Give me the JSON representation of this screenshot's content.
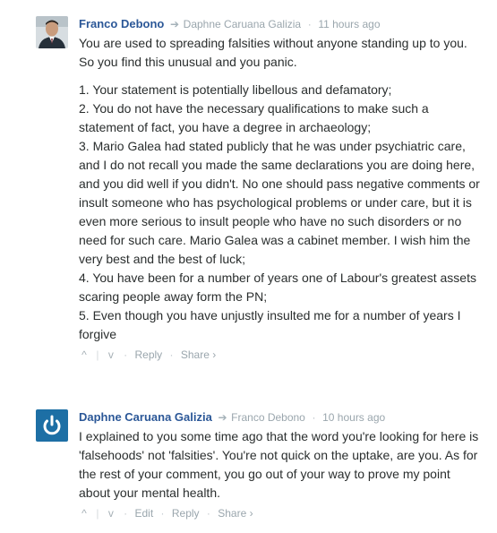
{
  "comments": [
    {
      "author": "Franco Debono",
      "reply_to": "Daphne Caruana Galizia",
      "separator": "·",
      "time": "11 hours ago",
      "paragraphs": [
        "You are used to spreading falsities without anyone standing up to you. So you find this unusual and you panic.",
        "1. Your statement is potentially libellous and defamatory;\n2. You do not have the necessary qualifications to make such a statement of fact, you have a degree in archaeology;\n3. Mario Galea had stated publicly that he was under psychiatric care, and I do not recall you made the same declarations you are doing here, and you did well if you didn't. No one should pass negative comments or insult someone who has psychological problems or under care, but it is even more serious to insult people who have no such disorders or no need for such care. Mario Galea was a cabinet member. I wish him the very best and the best of luck;\n4. You have been for a number of years one of Labour's greatest assets scaring people away form the PN;\n5. Even though you have unjustly insulted me for a number of years I forgive"
      ],
      "actions": {
        "reply": "Reply",
        "share": "Share ›"
      }
    },
    {
      "author": "Daphne Caruana Galizia",
      "reply_to": "Franco Debono",
      "separator": "·",
      "time": "10 hours ago",
      "paragraphs": [
        "I explained to you some time ago that the word you're looking for here is 'falsehoods' not 'falsities'. You're not quick on the uptake, are you. As for the rest of your comment, you go out of your way to prove my point about your mental health."
      ],
      "actions": {
        "edit": "Edit",
        "reply": "Reply",
        "share": "Share ›"
      }
    }
  ],
  "icons": {
    "reply_arrow": "reply-arrow-icon",
    "upvote": "chevron-up-icon",
    "downvote": "chevron-down-icon",
    "avatar_2": "power-logo-icon"
  },
  "colors": {
    "author": "#2b5797",
    "meta": "#9aa6ad",
    "text": "#2a2e2e",
    "avatar_2_bg": "#1d6fa5"
  }
}
